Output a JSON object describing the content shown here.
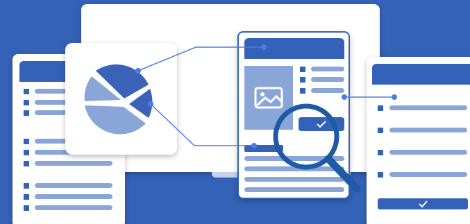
{
  "scene": {
    "description_free": true,
    "colors": {
      "background": "#3462b8",
      "card": "#ffffff",
      "header": "#3462b8",
      "bar_light": "#8aa6d8",
      "pie_dark": "#3a63b8",
      "pie_light": "#8aa6d8",
      "connector": "#4a7fe0",
      "magnifier": "#1f5aa5"
    },
    "icons": [
      "image-icon",
      "checkmark-icon",
      "magnifier-icon",
      "pie-chart-icon"
    ]
  }
}
